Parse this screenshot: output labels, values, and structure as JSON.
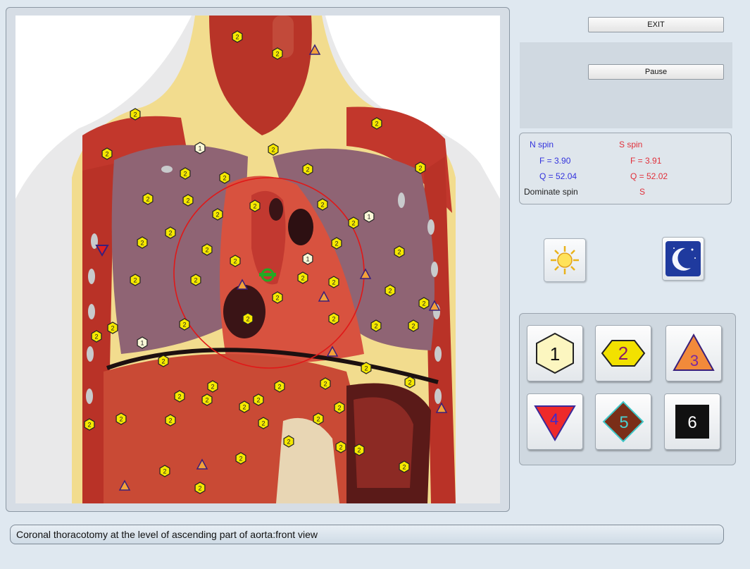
{
  "buttons": {
    "exit_label": "EXIT",
    "pause_label": "Pause"
  },
  "spin": {
    "n_header": "N spin",
    "s_header": "S spin",
    "n_f": "F =  3.90",
    "s_f": "F =  3.91",
    "n_q": "Q = 52.04",
    "s_q": "Q = 52.02",
    "dominate_label": "Dominate spin",
    "dominate_value": "S"
  },
  "mode_icons": {
    "day": "sun-icon",
    "night": "moon-icon"
  },
  "shape_buttons": [
    {
      "label": "1",
      "shape": "hexagon-light-yellow"
    },
    {
      "label": "2",
      "shape": "hexagon-yellow"
    },
    {
      "label": "3",
      "shape": "triangle-up-orange"
    },
    {
      "label": "4",
      "shape": "triangle-down-red"
    },
    {
      "label": "5",
      "shape": "diamond-brown"
    },
    {
      "label": "6",
      "shape": "square-black"
    }
  ],
  "image_markers": {
    "hexagon_label": "2",
    "hexagon1_label": "1"
  },
  "caption": "Coronal thoracotomy at the level of ascending part of aorta:front view",
  "colors": {
    "n_spin": "#3333dd",
    "s_spin": "#e0303a",
    "marker_yellow": "#f5e800",
    "focus_circle": "#e01818",
    "cursor_green": "#22aa22"
  }
}
